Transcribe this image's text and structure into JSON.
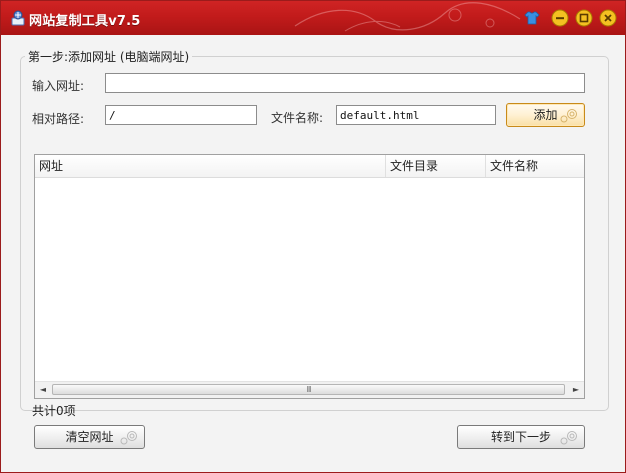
{
  "window": {
    "title": "网站复制工具v7.5"
  },
  "colors": {
    "titlebar": "#c21b1b",
    "accent_button": "#f9dfa5"
  },
  "step1": {
    "legend": "第一步:添加网址 (电脑端网址)",
    "url_label": "输入网址:",
    "url_value": "",
    "path_label": "相对路径:",
    "path_value": "/",
    "filename_label": "文件名称:",
    "filename_value": "default.html",
    "add_button": "添加"
  },
  "list": {
    "columns": [
      "网址",
      "文件目录",
      "文件名称"
    ],
    "rows": [],
    "scroll_grip": "III"
  },
  "footer": {
    "count_text": "共计0项",
    "clear_button": "清空网址",
    "next_button": "转到下一步"
  }
}
